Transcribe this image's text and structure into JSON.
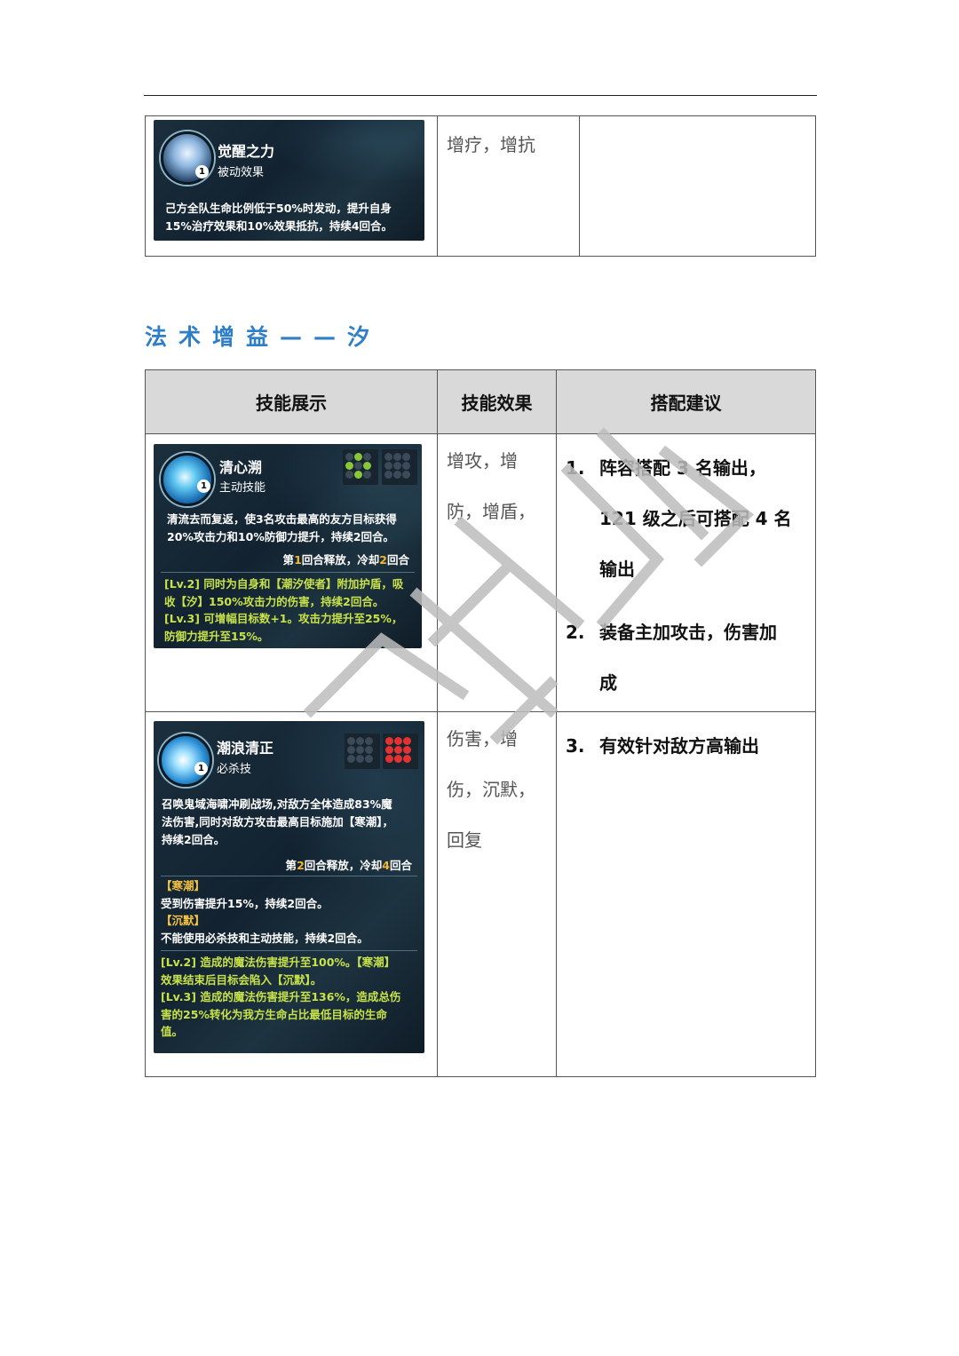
{
  "table1": {
    "card": {
      "name": "觉醒之力",
      "type": "被动效果",
      "level": "1",
      "desc_line1": "己方全队生命比例低于50%时发动，提升自身",
      "desc_line2": "15%治疗效果和10%效果抵抗，持续4回合。"
    },
    "effect": "增疗，增抗",
    "suggestion": ""
  },
  "section_title": "法术增益——汐",
  "table2": {
    "headers": [
      "技能展示",
      "技能效果",
      "搭配建议"
    ],
    "row1": {
      "card": {
        "name": "清心溯",
        "type": "主动技能",
        "level": "1",
        "desc_line1": "清流去而复返，使3名攻击最高的友方目标获得",
        "desc_line2": "20%攻击力和10%防御力提升，持续2回合。",
        "cd_pre": "第",
        "cd_round": "1",
        "cd_mid": "回合释放，冷却",
        "cd_cool": "2",
        "cd_post": "回合",
        "lv2_line1": "[Lv.2] 同时为自身和【潮汐使者】附加护盾，吸",
        "lv2_line2": "收【汐】150%攻击力的伤害，持续2回合。",
        "lv3_line1": "[Lv.3] 可增幅目标数+1。攻击力提升至25%，",
        "lv3_line2": "防御力提升至15%。"
      },
      "effect": [
        "增攻，增",
        "防，增盾，"
      ],
      "suggestions": [
        {
          "num": "1.",
          "lines": [
            "阵容搭配 3 名输出，",
            "121 级之后可搭配 4 名",
            "输出"
          ]
        },
        {
          "num": "2.",
          "lines": [
            "装备主加攻击，伤害加",
            "成"
          ]
        }
      ]
    },
    "row2": {
      "card": {
        "name": "潮浪清正",
        "type": "必杀技",
        "level": "1",
        "desc_line1": "召唤鬼域海啸冲刷战场,对敌方全体造成83%魔",
        "desc_line2": "法伤害,同时对敌方攻击最高目标施加【寒潮】，",
        "desc_line3": "持续2回合。",
        "cd_pre": "第",
        "cd_round": "2",
        "cd_mid": "回合释放，冷却",
        "cd_cool": "4",
        "cd_post": "回合",
        "status1_title": "【寒潮】",
        "status1_desc": "受到伤害提升15%，持续2回合。",
        "status2_title": "【沉默】",
        "status2_desc": "不能使用必杀技和主动技能，持续2回合。",
        "lv2_line1": "[Lv.2] 造成的魔法伤害提升至100%。【寒潮】",
        "lv2_line2": "效果结束后目标会陷入【沉默】。",
        "lv3_line1": "[Lv.3] 造成的魔法伤害提升至136%，造成总伤",
        "lv3_line2": "害的25%转化为我方生命占比最低目标的生命",
        "lv3_line3": "值。"
      },
      "effect": [
        "伤害，增",
        "伤，沉默，",
        "回复"
      ],
      "suggestions": [
        {
          "num": "3.",
          "lines": [
            "有效针对敌方高输出"
          ]
        }
      ]
    }
  },
  "colors": {
    "title_blue": "#2e7ec8",
    "header_gray": "#d9d9d9",
    "card_bg": "#142633",
    "lv_green": "#c8e24a",
    "cd_orange": "#f5b829",
    "hex_green": "#88c63a",
    "hex_red": "#e23232"
  },
  "watermark": "seal-like gray watermark"
}
